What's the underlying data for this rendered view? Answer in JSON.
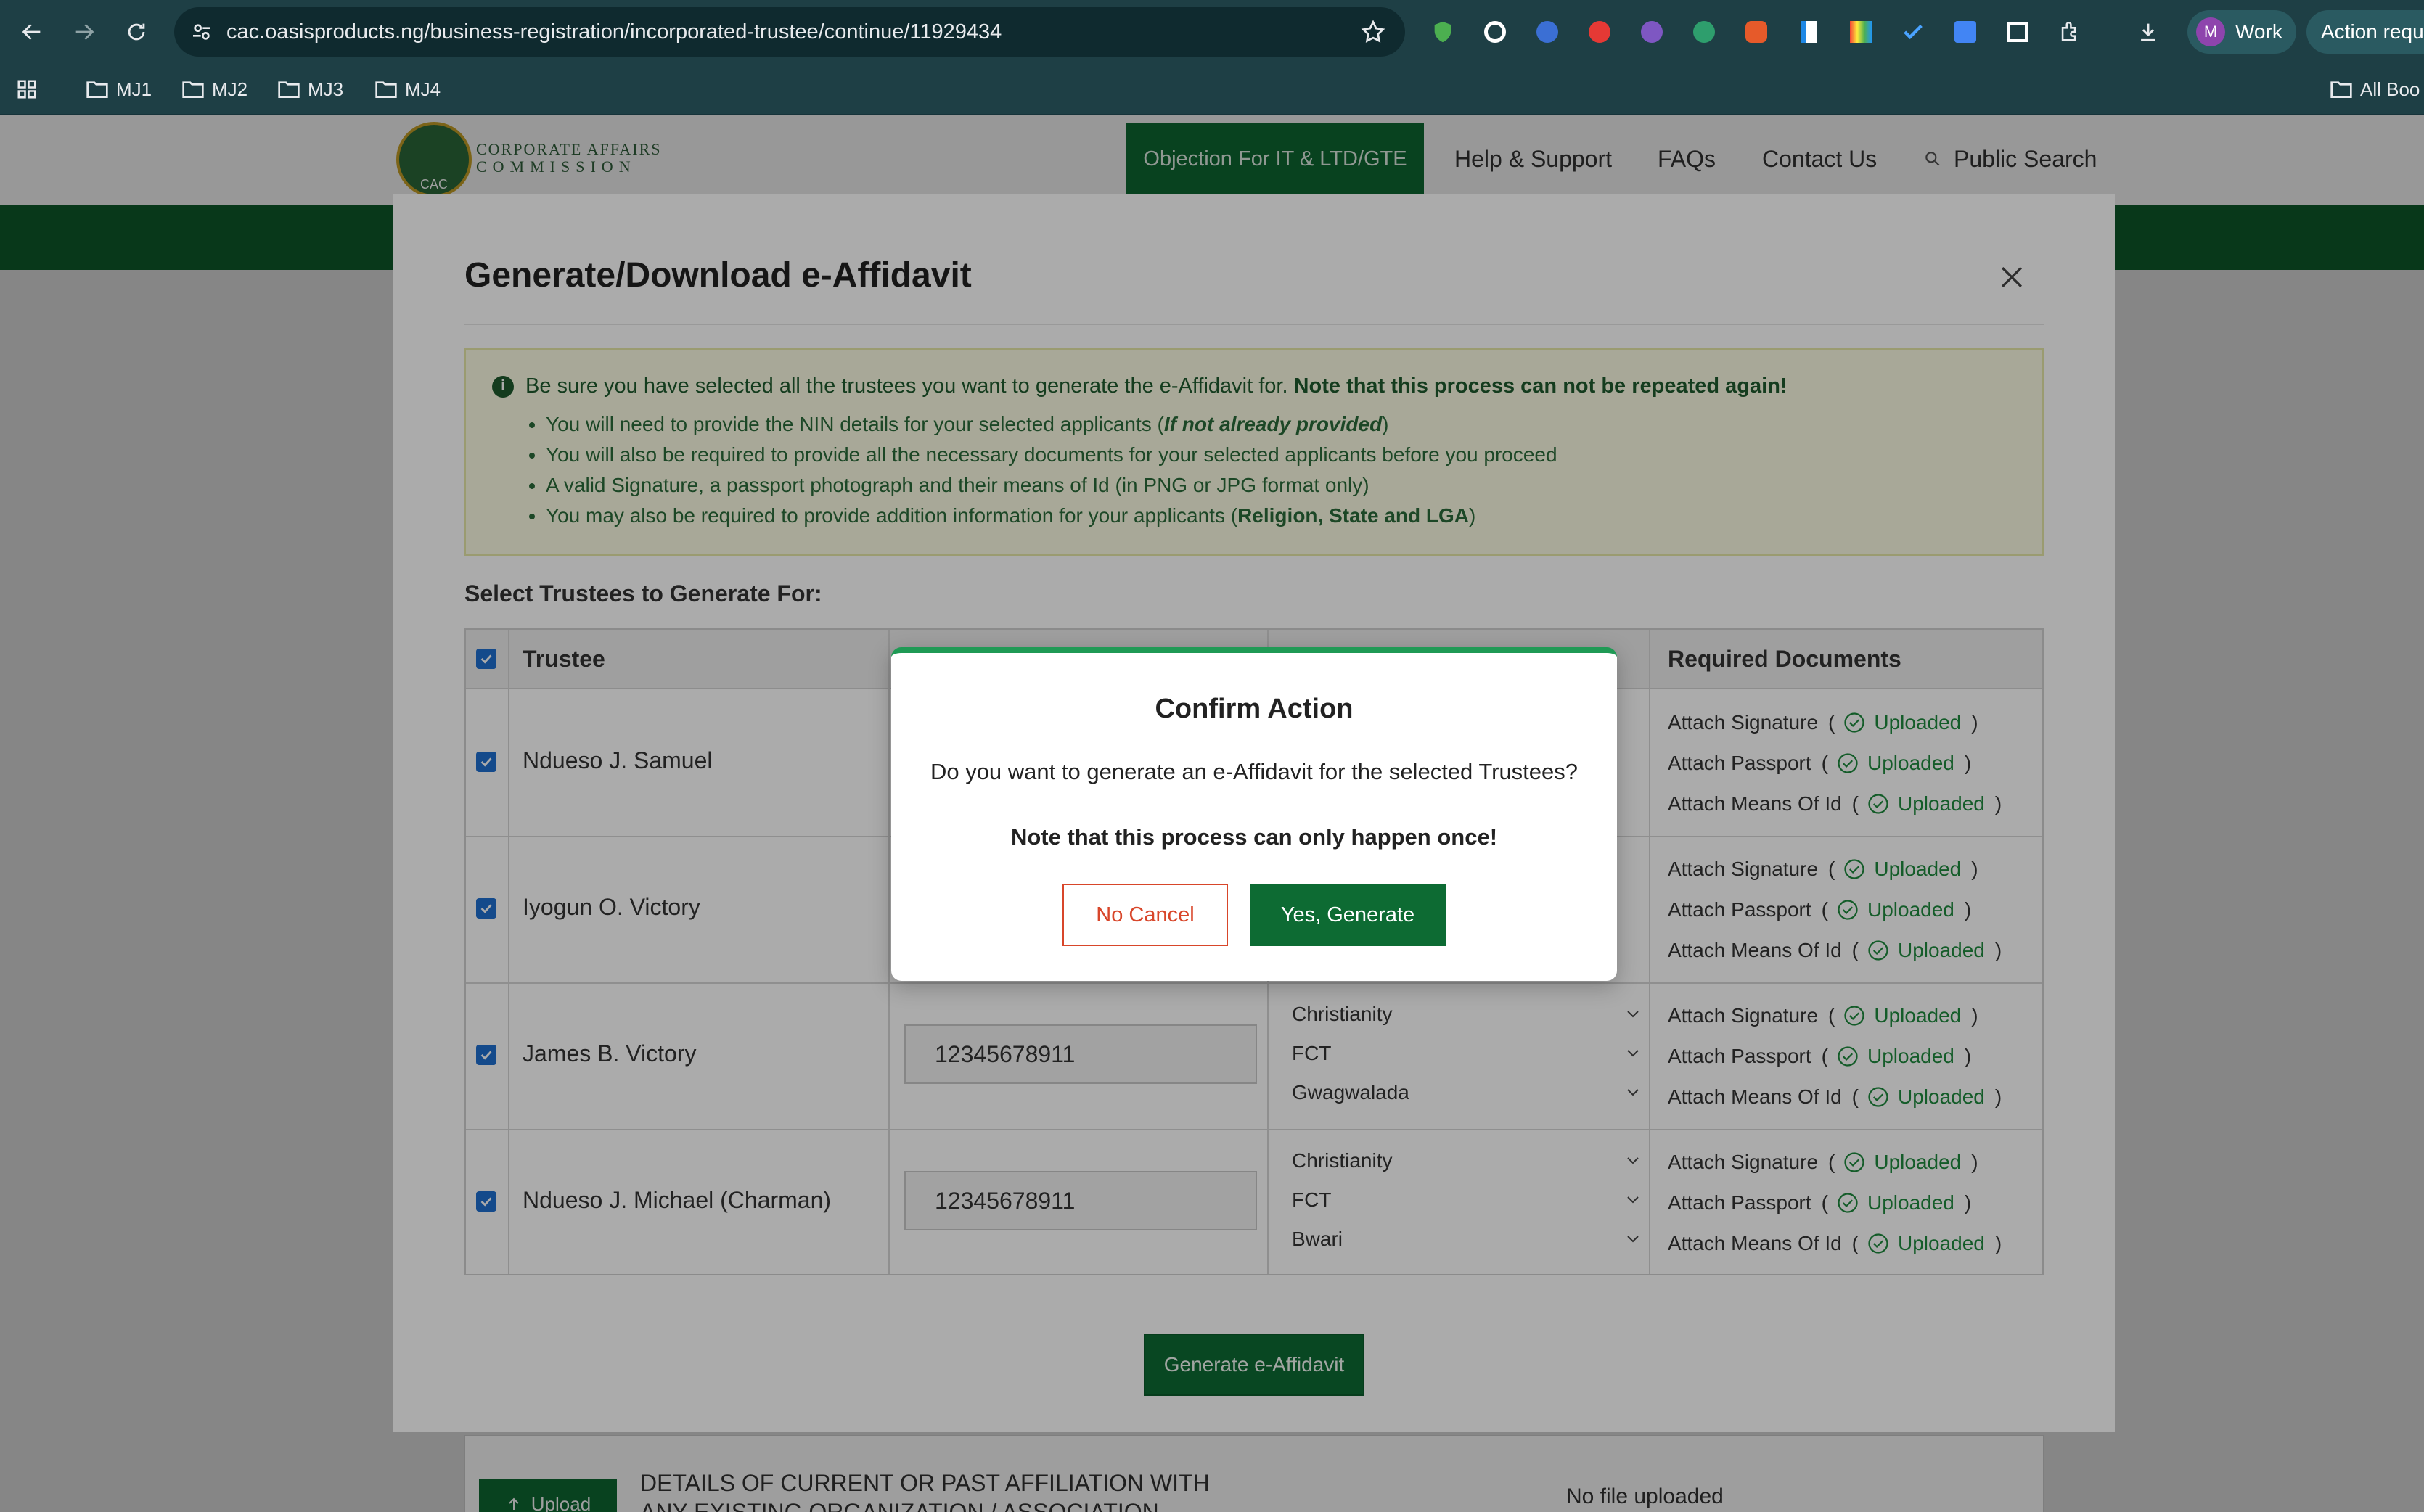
{
  "browser": {
    "url": "cac.oasisproducts.ng/business-registration/incorporated-trustee/continue/11929434",
    "profile_initial": "M",
    "profile_label": "Work",
    "action_chip": "Action requ",
    "bookmarks": [
      "MJ1",
      "MJ2",
      "MJ3",
      "MJ4"
    ],
    "all_bookmarks": "All Boo"
  },
  "site": {
    "logo_line1": "CORPORATE AFFAIRS",
    "logo_line2": "COMMISSION",
    "logo_seal_text": "CAC",
    "nav": [
      "Objection For IT & LTD/GTE",
      "Help & Support",
      "FAQs",
      "Contact Us",
      "Public Search"
    ]
  },
  "background": {
    "upload_label": "Upload",
    "affiliation_text": "DETAILS OF CURRENT OR PAST AFFILIATION WITH ANY EXISTING ORGANIZATION / ASSOCIATION",
    "no_file": "No file uploaded"
  },
  "modal": {
    "title": "Generate/Download e-Affidavit",
    "notice_head": "Be sure you have selected all the trustees you want to generate the e-Affidavit for.",
    "notice_head_bold": "Note that this process can not be repeated again!",
    "bullets": [
      {
        "text": "You will need to provide the NIN details for your selected applicants (",
        "emph": "If not already provided",
        "tail": ")"
      },
      {
        "text": "You will also be required to provide all the necessary documents for your selected applicants before you proceed",
        "emph": "",
        "tail": ""
      },
      {
        "text": "A valid Signature, a passport photograph and their means of Id (in PNG or JPG format only)",
        "emph": "",
        "tail": ""
      },
      {
        "text": "You may also be required to provide addition information for your applicants (",
        "emph": "Religion, State and LGA",
        "tail": ")"
      }
    ],
    "select_label": "Select Trustees to Generate For:",
    "columns": {
      "trustee": "Trustee",
      "docs": "Required Documents"
    },
    "doc_labels": [
      "Attach Signature",
      "Attach Passport",
      "Attach Means Of Id"
    ],
    "doc_status": "Uploaded",
    "rows": [
      {
        "name": "Ndueso J. Samuel",
        "nin": "",
        "religion": "",
        "state": "",
        "lga": ""
      },
      {
        "name": "Iyogun O. Victory",
        "nin": "",
        "religion": "",
        "state": "",
        "lga": ""
      },
      {
        "name": "James B. Victory",
        "nin": "12345678911",
        "religion": "Christianity",
        "state": "FCT",
        "lga": "Gwagwalada"
      },
      {
        "name": "Ndueso J. Michael (Charman)",
        "nin": "12345678911",
        "religion": "Christianity",
        "state": "FCT",
        "lga": "Bwari"
      }
    ],
    "generate_button": "Generate e-Affidavit"
  },
  "confirm": {
    "title": "Confirm Action",
    "question": "Do you want to generate an e-Affidavit for the selected Trustees?",
    "note": "Note that this process can only happen once!",
    "cancel": "No Cancel",
    "yes": "Yes, Generate"
  },
  "colors": {
    "brand_green": "#0d6b33",
    "uploaded_green": "#1e8a3e",
    "cancel_red": "#d8462a",
    "checkbox_blue": "#1f6fd0"
  }
}
